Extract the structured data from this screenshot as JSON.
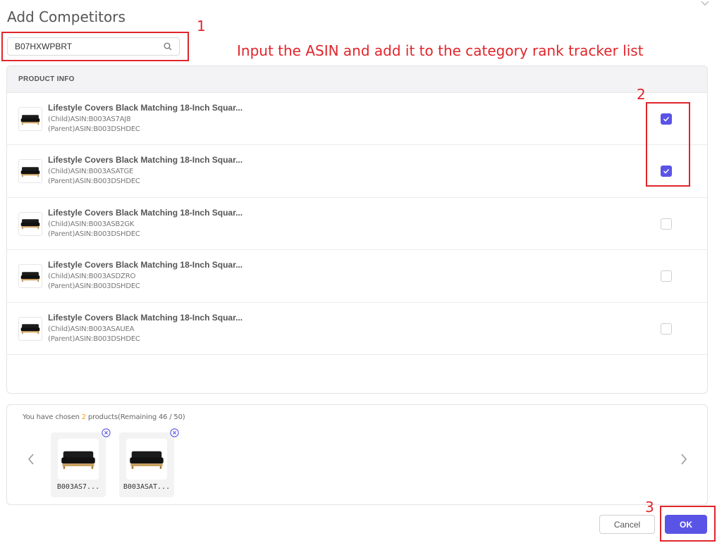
{
  "dialog": {
    "title": "Add Competitors"
  },
  "search": {
    "value": "B07HXWPBRT",
    "icon": "search-icon"
  },
  "annotations": {
    "step1": "1",
    "step2": "2",
    "step3": "3",
    "instruction": "Input the ASIN and add it to the category rank tracker list",
    "color": "#e0252b"
  },
  "table": {
    "header": "PRODUCT INFO",
    "rows": [
      {
        "name": "Lifestyle Covers Black Matching 18-Inch Squar...",
        "child": "(Child)ASIN:B003AS7AJ8",
        "parent": "(Parent)ASIN:B003DSHDEC",
        "checked": true
      },
      {
        "name": "Lifestyle Covers Black Matching 18-Inch Squar...",
        "child": "(Child)ASIN:B003ASATGE",
        "parent": "(Parent)ASIN:B003DSHDEC",
        "checked": true
      },
      {
        "name": "Lifestyle Covers Black Matching 18-Inch Squar...",
        "child": "(Child)ASIN:B003ASB2GK",
        "parent": "(Parent)ASIN:B003DSHDEC",
        "checked": false
      },
      {
        "name": "Lifestyle Covers Black Matching 18-Inch Squar...",
        "child": "(Child)ASIN:B003ASDZRO",
        "parent": "(Parent)ASIN:B003DSHDEC",
        "checked": false
      },
      {
        "name": "Lifestyle Covers Black Matching 18-Inch Squar...",
        "child": "(Child)ASIN:B003ASAUEA",
        "parent": "(Parent)ASIN:B003DSHDEC",
        "checked": false
      }
    ]
  },
  "chosen": {
    "prefix": "You have chosen ",
    "count": "2",
    "suffix": " products(Remaining 46 / 50)",
    "items": [
      {
        "label": "B003AS7..."
      },
      {
        "label": "B003ASAT..."
      }
    ]
  },
  "buttons": {
    "cancel": "Cancel",
    "ok": "OK"
  },
  "colors": {
    "accent": "#5a54e6",
    "highlight_count": "#f0a020"
  }
}
